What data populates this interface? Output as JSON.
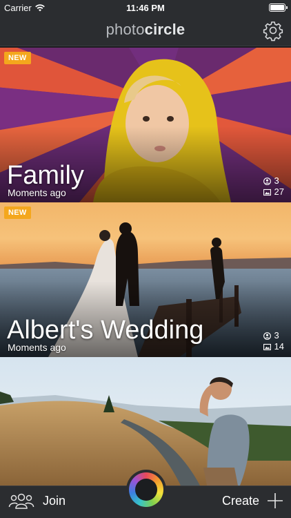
{
  "status_bar": {
    "carrier": "Carrier",
    "time": "11:46 PM"
  },
  "navbar": {
    "logo_light": "photo",
    "logo_bold": "circle"
  },
  "albums": [
    {
      "badge": "NEW",
      "title": "Family",
      "subtitle": "Moments ago",
      "members": "3",
      "photos": "27"
    },
    {
      "badge": "NEW",
      "title": "Albert's Wedding",
      "subtitle": "Moments ago",
      "members": "3",
      "photos": "14"
    },
    {
      "badge": "",
      "title": "",
      "subtitle": "",
      "members": "",
      "photos": ""
    }
  ],
  "tabbar": {
    "join_label": "Join",
    "create_label": "Create"
  },
  "colors": {
    "badge": "#f4a71d",
    "bar": "#2b2d30"
  }
}
